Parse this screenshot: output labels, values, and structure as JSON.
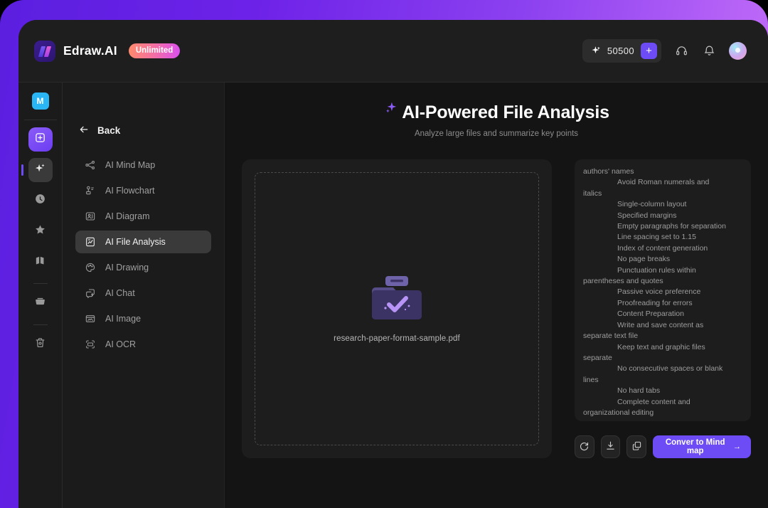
{
  "header": {
    "brand_name": "Edraw.AI",
    "plan_badge": "Unlimited",
    "credits_value": "50500",
    "credits_icon": "sparkle-icon",
    "add_credits_label": "+",
    "support_icon": "headset-icon",
    "notifications_icon": "bell-icon",
    "avatar_label": "user-avatar"
  },
  "rail": {
    "workspace_badge": "M",
    "items": [
      {
        "name": "new-item",
        "icon": "plus-square-icon",
        "active": false
      },
      {
        "name": "ai-tools",
        "icon": "sparkle-icon",
        "active": true
      },
      {
        "name": "recent",
        "icon": "clock-icon",
        "active": false
      },
      {
        "name": "favorites",
        "icon": "star-icon",
        "active": false
      },
      {
        "name": "templates",
        "icon": "chart-icon",
        "active": false
      },
      {
        "name": "files",
        "icon": "folder-icon",
        "active": false
      },
      {
        "name": "trash",
        "icon": "trash-icon",
        "active": false
      }
    ]
  },
  "sidebar": {
    "back_label": "Back",
    "items": [
      {
        "label": "AI Mind Map",
        "icon": "mindmap-icon",
        "active": false
      },
      {
        "label": "AI Flowchart",
        "icon": "flowchart-icon",
        "active": false
      },
      {
        "label": "AI Diagram",
        "icon": "diagram-icon",
        "active": false
      },
      {
        "label": "AI File Analysis",
        "icon": "file-chart-icon",
        "active": true
      },
      {
        "label": "AI Drawing",
        "icon": "palette-icon",
        "active": false
      },
      {
        "label": "AI Chat",
        "icon": "chat-icon",
        "active": false
      },
      {
        "label": "AI Image",
        "icon": "image-icon",
        "active": false
      },
      {
        "label": "AI OCR",
        "icon": "ocr-icon",
        "active": false
      }
    ]
  },
  "main": {
    "title": "AI-Powered File Analysis",
    "subtitle": "Analyze large files and summarize key points",
    "upload": {
      "file_name": "research-paper-format-sample.pdf",
      "file_icon": "folder-check-icon"
    },
    "result_lines": [
      {
        "text": "authors' names",
        "indented": false
      },
      {
        "text": "Avoid Roman numerals and",
        "indented": true
      },
      {
        "text": "italics",
        "indented": false
      },
      {
        "text": "Single-column layout",
        "indented": true
      },
      {
        "text": "Specified margins",
        "indented": true
      },
      {
        "text": "Empty paragraphs for separation",
        "indented": true
      },
      {
        "text": "Line spacing set to 1.15",
        "indented": true
      },
      {
        "text": "Index of content generation",
        "indented": true
      },
      {
        "text": "No page breaks",
        "indented": true
      },
      {
        "text": "Punctuation rules within",
        "indented": true
      },
      {
        "text": "parentheses and quotes",
        "indented": false
      },
      {
        "text": "Passive voice preference",
        "indented": true
      },
      {
        "text": "Proofreading for errors",
        "indented": true
      },
      {
        "text": "Content Preparation",
        "indented": true
      },
      {
        "text": "Write and save content as",
        "indented": true
      },
      {
        "text": "separate text file",
        "indented": false
      },
      {
        "text": "Keep text and graphic files",
        "indented": true
      },
      {
        "text": "separate",
        "indented": false
      },
      {
        "text": "No consecutive spaces or blank",
        "indented": true
      },
      {
        "text": "lines",
        "indented": false
      },
      {
        "text": "No hard tabs",
        "indented": true
      },
      {
        "text": "Complete content and",
        "indented": true
      },
      {
        "text": "organizational editing",
        "indented": false
      }
    ],
    "actions": {
      "regenerate_icon": "refresh-icon",
      "download_icon": "download-icon",
      "copy_icon": "copy-icon",
      "convert_label": "Conver to Mind map",
      "convert_arrow": "→"
    }
  },
  "colors": {
    "accent": "#6d4bf5",
    "frame_gradient_start": "#5b1fe0",
    "frame_gradient_end": "#c06ef8",
    "badge_gradient_start": "#ff8a6b",
    "badge_gradient_end": "#d94ff0",
    "workspace_badge": "#2ab5f5"
  }
}
